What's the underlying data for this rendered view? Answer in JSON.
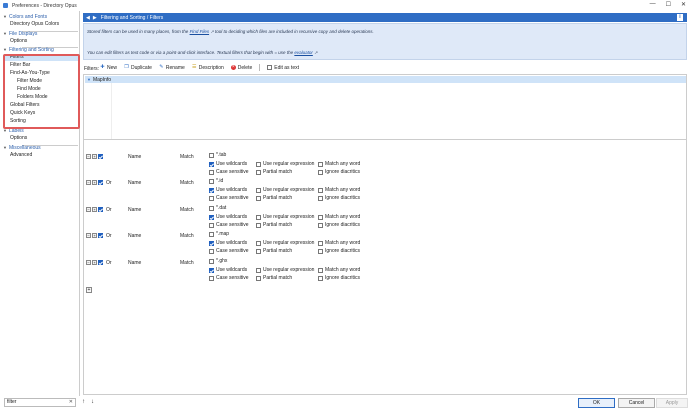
{
  "window": {
    "title": "Preferences - Directory Opus",
    "min_icon": "minimize-icon",
    "max_icon": "maximize-icon",
    "close_icon": "close-icon"
  },
  "sidebar": {
    "items": [
      {
        "label": "Colors and Fonts",
        "type": "group"
      },
      {
        "label": "Directory Opus Colors",
        "type": "item"
      },
      {
        "label": "File Displays",
        "type": "group"
      },
      {
        "label": "Options",
        "type": "item"
      },
      {
        "label": "Filtering and Sorting",
        "type": "group"
      },
      {
        "label": "Filters",
        "type": "item",
        "selected": true
      },
      {
        "label": "Filter Bar",
        "type": "item"
      },
      {
        "label": "Find-As-You-Type",
        "type": "item"
      },
      {
        "label": "Filter Mode",
        "type": "sub"
      },
      {
        "label": "Find Mode",
        "type": "sub"
      },
      {
        "label": "Folders Mode",
        "type": "sub"
      },
      {
        "label": "Global Filters",
        "type": "item"
      },
      {
        "label": "Quick Keys",
        "type": "item"
      },
      {
        "label": "Sorting",
        "type": "item"
      },
      {
        "label": "Labels",
        "type": "group"
      },
      {
        "label": "Options",
        "type": "item"
      },
      {
        "label": "Miscellaneous",
        "type": "group"
      },
      {
        "label": "Advanced",
        "type": "item"
      }
    ],
    "search_value": "filter"
  },
  "header": {
    "title": "Filtering and Sorting / Filters",
    "info": "i"
  },
  "info": {
    "line1_a": "Stored filters can be used in many places, from the ",
    "line1_link": "Find Files",
    "line1_b": " tool to deciding which files are included in recursive copy and delete operations.",
    "line2_a": "You can edit filters as text code or via a point-and-click interface. Textual filters that begin with = use the ",
    "line2_link": "evaluator"
  },
  "toolbar": {
    "filters_label": "Filters:",
    "new": "New",
    "duplicate": "Duplicate",
    "rename": "Rename",
    "description": "Description",
    "delete": "Delete",
    "edit_as_text": "Edit as text"
  },
  "filter_list": {
    "rows": [
      "MapInfo"
    ]
  },
  "rules": [
    {
      "conj": "",
      "field": "Name",
      "match": "Match",
      "pattern": "*.tab"
    },
    {
      "conj": "Or",
      "field": "Name",
      "match": "Match",
      "pattern": "*.id"
    },
    {
      "conj": "Or",
      "field": "Name",
      "match": "Match",
      "pattern": "*.dat"
    },
    {
      "conj": "Or",
      "field": "Name",
      "match": "Match",
      "pattern": "*.map"
    },
    {
      "conj": "Or",
      "field": "Name",
      "match": "Match",
      "pattern": "*.ghx"
    }
  ],
  "rule_options": {
    "use_wildcards": "Use wildcards",
    "use_regex": "Use regular expression",
    "match_any_word": "Match any word",
    "case_sensitive": "Case sensitive",
    "partial_match": "Partial match",
    "ignore_diacritics": "Ignore diacritics"
  },
  "buttons": {
    "ok": "OK",
    "cancel": "Cancel",
    "apply": "Apply"
  }
}
